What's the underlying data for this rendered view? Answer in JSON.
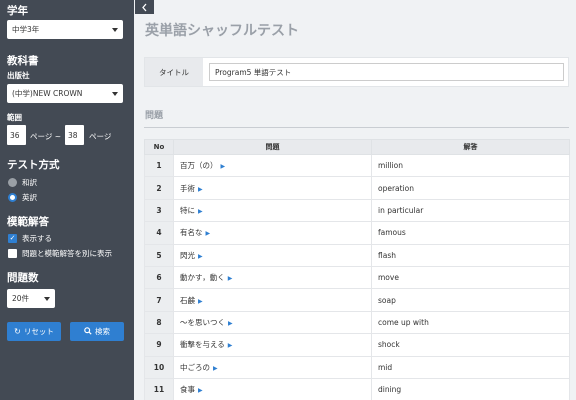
{
  "sidebar": {
    "grade_title": "学年",
    "grade_value": "中学3年",
    "textbook_title": "教科書",
    "publisher_label": "出版社",
    "publisher_value": "(中学)NEW CROWN",
    "range_label": "範囲",
    "page_from": "36",
    "page_sep": "ページ ~",
    "page_to": "38",
    "page_suffix": "ページ",
    "test_method_title": "テスト方式",
    "radio_japanese": "和訳",
    "radio_english": "英訳",
    "model_answer_title": "模範解答",
    "check_show": "表示する",
    "check_separate": "問題と模範解答を別に表示",
    "count_title": "問題数",
    "count_value": "20件",
    "reset_label": "リセット",
    "search_label": "検索"
  },
  "main": {
    "title": "英単語シャッフルテスト",
    "title_field_label": "タイトル",
    "title_field_value": "Program5 単語テスト",
    "section_heading": "問題",
    "columns": [
      "No",
      "問題",
      "解答"
    ],
    "rows": [
      {
        "no": "1",
        "q": "百万（の）",
        "a": "million"
      },
      {
        "no": "2",
        "q": "手術",
        "a": "operation"
      },
      {
        "no": "3",
        "q": "特に",
        "a": "in particular"
      },
      {
        "no": "4",
        "q": "有名な",
        "a": "famous"
      },
      {
        "no": "5",
        "q": "閃光",
        "a": "flash"
      },
      {
        "no": "6",
        "q": "動かす，動く",
        "a": "move"
      },
      {
        "no": "7",
        "q": "石鹸",
        "a": "soap"
      },
      {
        "no": "8",
        "q": "～を思いつく",
        "a": "come up with"
      },
      {
        "no": "9",
        "q": "衝撃を与える",
        "a": "shock"
      },
      {
        "no": "10",
        "q": "中ごろの",
        "a": "mid"
      },
      {
        "no": "11",
        "q": "食事",
        "a": "dining"
      }
    ]
  },
  "colors": {
    "sidebar_bg": "#434a54",
    "accent": "#2f7fd1",
    "title_gray": "#9aa0a8"
  }
}
